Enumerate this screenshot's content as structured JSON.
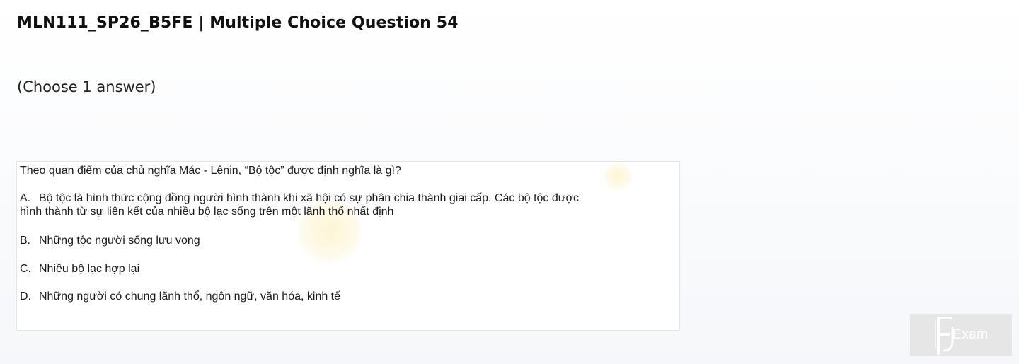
{
  "header": {
    "title": "MLN111_SP26_B5FE | Multiple Choice Question 54",
    "instruction": "(Choose 1 answer)"
  },
  "question": {
    "stem": "Theo quan điểm của chủ nghĩa Mác - Lênin, “Bộ tộc” được định nghĩa là gì?",
    "options": [
      {
        "letter": "A.",
        "text_line1": "Bộ tộc là hình thức cộng đồng người hình thành khi xã hội có sự phân chia thành giai cấp. Các bộ tộc được",
        "text_line2": "hình thành từ sự liên kết của nhiều bộ lạc sống trên một lãnh thổ nhất định"
      },
      {
        "letter": "B.",
        "text": "Những tộc người sống lưu vong"
      },
      {
        "letter": "C.",
        "text": "Nhiều bộ lạc hợp lại"
      },
      {
        "letter": "D.",
        "text": "Những người có chung lãnh thổ, ngôn ngữ, văn hóa, kinh tế"
      }
    ]
  },
  "logo": {
    "text": "Exam",
    "icon": "fu-exam-logo-icon"
  }
}
